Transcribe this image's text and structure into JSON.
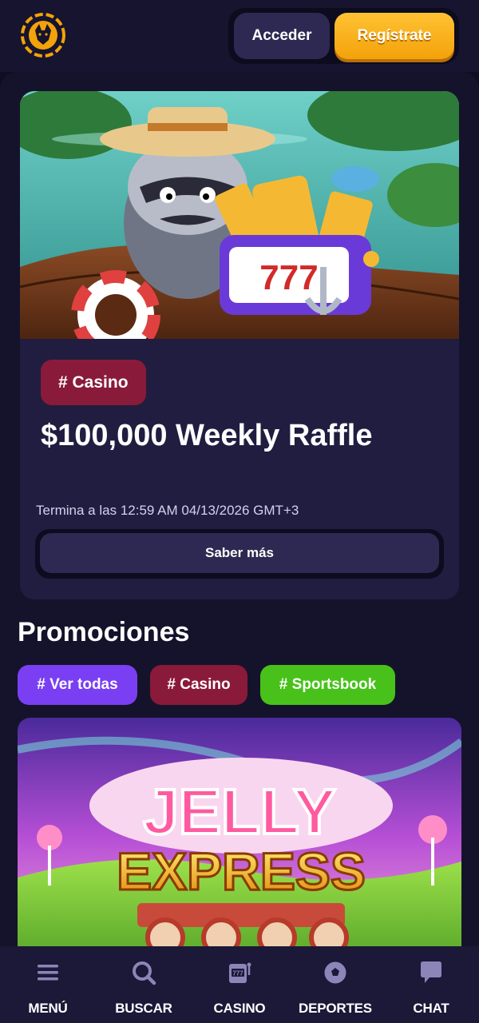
{
  "header": {
    "logo_icon": "fox-coin-logo-icon",
    "login_label": "Acceder",
    "register_label": "Regístrate"
  },
  "featured": {
    "tag": "# Casino",
    "title": "$100,000 Weekly Raffle",
    "end_text": "Termina a las 12:59 AM 04/13/2026 GMT+3",
    "button_label": "Saber más",
    "slot_text": "777"
  },
  "promotions": {
    "title": "Promociones",
    "filters": [
      {
        "label": "# Ver todas",
        "color": "#7a3ff2"
      },
      {
        "label": "# Casino",
        "color": "#8a1a3a"
      },
      {
        "label": "# Sportsbook",
        "color": "#48c21a"
      }
    ],
    "banner": {
      "line1": "JELLY",
      "line2": "EXPRESS"
    }
  },
  "nav": [
    {
      "label": "MENÚ",
      "icon": "hamburger-menu-icon"
    },
    {
      "label": "BUSCAR",
      "icon": "search-icon"
    },
    {
      "label": "CASINO",
      "icon": "slot-machine-icon"
    },
    {
      "label": "DEPORTES",
      "icon": "soccer-ball-icon"
    },
    {
      "label": "CHAT",
      "icon": "chat-bubble-icon"
    }
  ],
  "colors": {
    "background": "#0f0d24",
    "accent_yellow": "#ffc233",
    "card": "#201d40"
  }
}
